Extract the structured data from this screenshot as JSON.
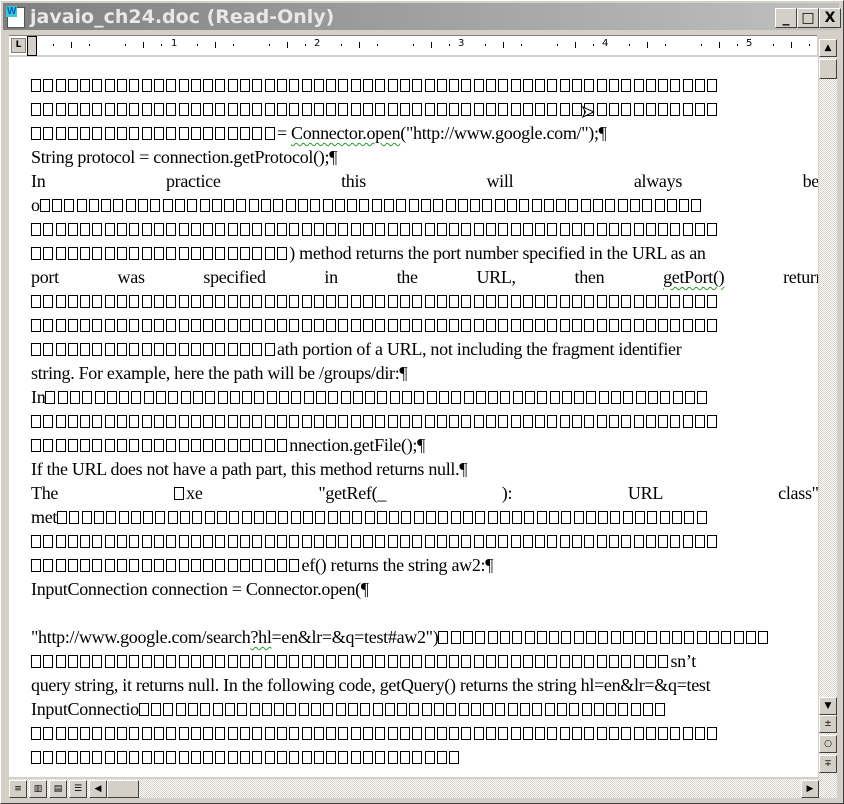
{
  "window": {
    "title": "javaio_ch24.doc (Read-Only)",
    "app_icon_letter": "W",
    "minimize": "_",
    "maximize": "□",
    "close": "X"
  },
  "ruler": {
    "tab_stop": "L",
    "numbers": [
      "1",
      "2",
      "3",
      "4",
      "5"
    ]
  },
  "document": {
    "lines": [
      "□□□□□□□□□□□□□□□□□□□□□□□□□□□□□□□□□□□□□□□□□□□□□□□□□□□□□□□□",
      "□□□□□□□□□□□□□□□□□□□□□□□□□□□□□□□□□□□□□□□□□□□□□□□□□□□□□□□□",
      "□□□□□□□□□□□□□□□□□□□□= ",
      "String protocol = connection.getProtocol();¶",
      "In practice this will always be",
      "o□□□□□□□□□□□□□□□□□□□□□□□□□□□□□□□□□□□□□□□□□□□□□□□□□□□□□□",
      "□□□□□□□□□□□□□□□□□□□□□□□□□□□□□□□□□□□□□□□□□□□□□□□□□□□□□□□□",
      "□□□□□□□□□□□□□□□□□□□□□) method returns the port number specified in the URL as an",
      "port was specified in the URL, then ",
      "□□□□□□□□□□□□□□□□□□□□□□□□□□□□□□□□□□□□□□□□□□□□□□□□□□□□□□□□",
      "□□□□□□□□□□□□□□□□□□□□□□□□□□□□□□□□□□□□□□□□□□□□□□□□□□□□□□□□",
      "□□□□□□□□□□□□□□□□□□□□ath portion of a URL, not including the fragment identifier",
      "string. For example, here the path will be /groups/dir:¶",
      "In□□□□□□□□□□□□□□□□□□□□□□□□□□□□□□□□□□□□□□□□□□□□□□□□□□□□□□",
      "□□□□□□□□□□□□□□□□□□□□□□□□□□□□□□□□□□□□□□□□□□□□□□□□□□□□□□□□",
      "□□□□□□□□□□□□□□□□□□□□□nnection.getFile();¶",
      "If the URL does not have a path part, this method returns null.¶",
      "The □xe \"getRef(_ ): URL class\"□",
      "met□□□□□□□□□□□□□□□□□□□□□□□□□□□□□□□□□□□□□□□□□□□□□□□□□□□□□",
      "□□□□□□□□□□□□□□□□□□□□□□□□□□□□□□□□□□□□□□□□□□□□□□□□□□□□□□□□",
      "□□□□□□□□□□□□□□□□□□□□□□ef() returns the string aw2:¶",
      "InputConnection connection = Connector.open(¶",
      "",
      "\"http://www.google.com/search",
      "□□□□□□□□□□□□□□□□□□□□□□□□□□□□□□□□□□□□□□□□□□□□□□□□□□□□sn’t",
      "query string, it returns null. In the following code, getQuery() returns the string hl=en&lr=&q=test",
      "InputConnectio□□□□□□□□□□□□□□□□□□□□□□□□□□□□□□□□□□□□□□□□□□□",
      "□□□□□□□□□□□□□□□□□□□□□□□□□□□□□□□□□□□□□□□□□□□□□□□□□□□□□□□□",
      "□□□□□□□□□□□□□□□□□□□□□□□□□□□□□□□□□□□"
    ],
    "line3_underlined": "Connector.open",
    "line3_rest": "(\"http://www.google.com/\");¶",
    "line9_underlined": "getPort()",
    "line9_rest": " returns",
    "line24_underlined": "?hl",
    "line24_rest": "=en&lr=&q=test#aw2\")□□□□□□□□□□□□□□□□□□□□□□□□□□□"
  },
  "status": {
    "view_buttons": [
      "normal-view",
      "web-layout-view",
      "print-layout-view",
      "outline-view"
    ]
  }
}
